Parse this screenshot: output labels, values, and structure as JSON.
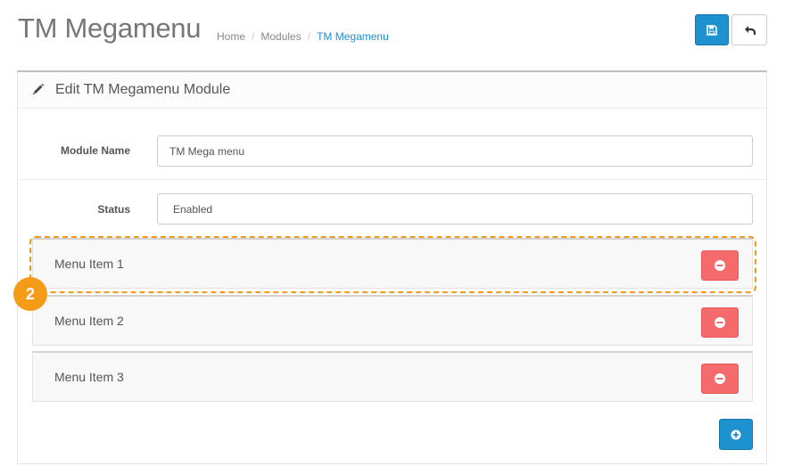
{
  "header": {
    "title": "TM Megamenu",
    "breadcrumb": [
      "Home",
      "Modules",
      "TM Megamenu"
    ],
    "save_icon": "floppy-disk-icon",
    "back_icon": "reply-arrow-icon"
  },
  "panel": {
    "title": "Edit TM Megamenu Module",
    "title_icon": "pencil-icon"
  },
  "form": {
    "module_name_label": "Module Name",
    "module_name_value": "TM Mega menu",
    "status_label": "Status",
    "status_value": "Enabled"
  },
  "menu_items": [
    {
      "label": "Menu Item 1"
    },
    {
      "label": "Menu Item 2"
    },
    {
      "label": "Menu Item 3"
    }
  ],
  "annotation": {
    "step": "2",
    "color": "#f49b17"
  },
  "colors": {
    "primary": "#1e91cf",
    "danger": "#f56b6b"
  }
}
